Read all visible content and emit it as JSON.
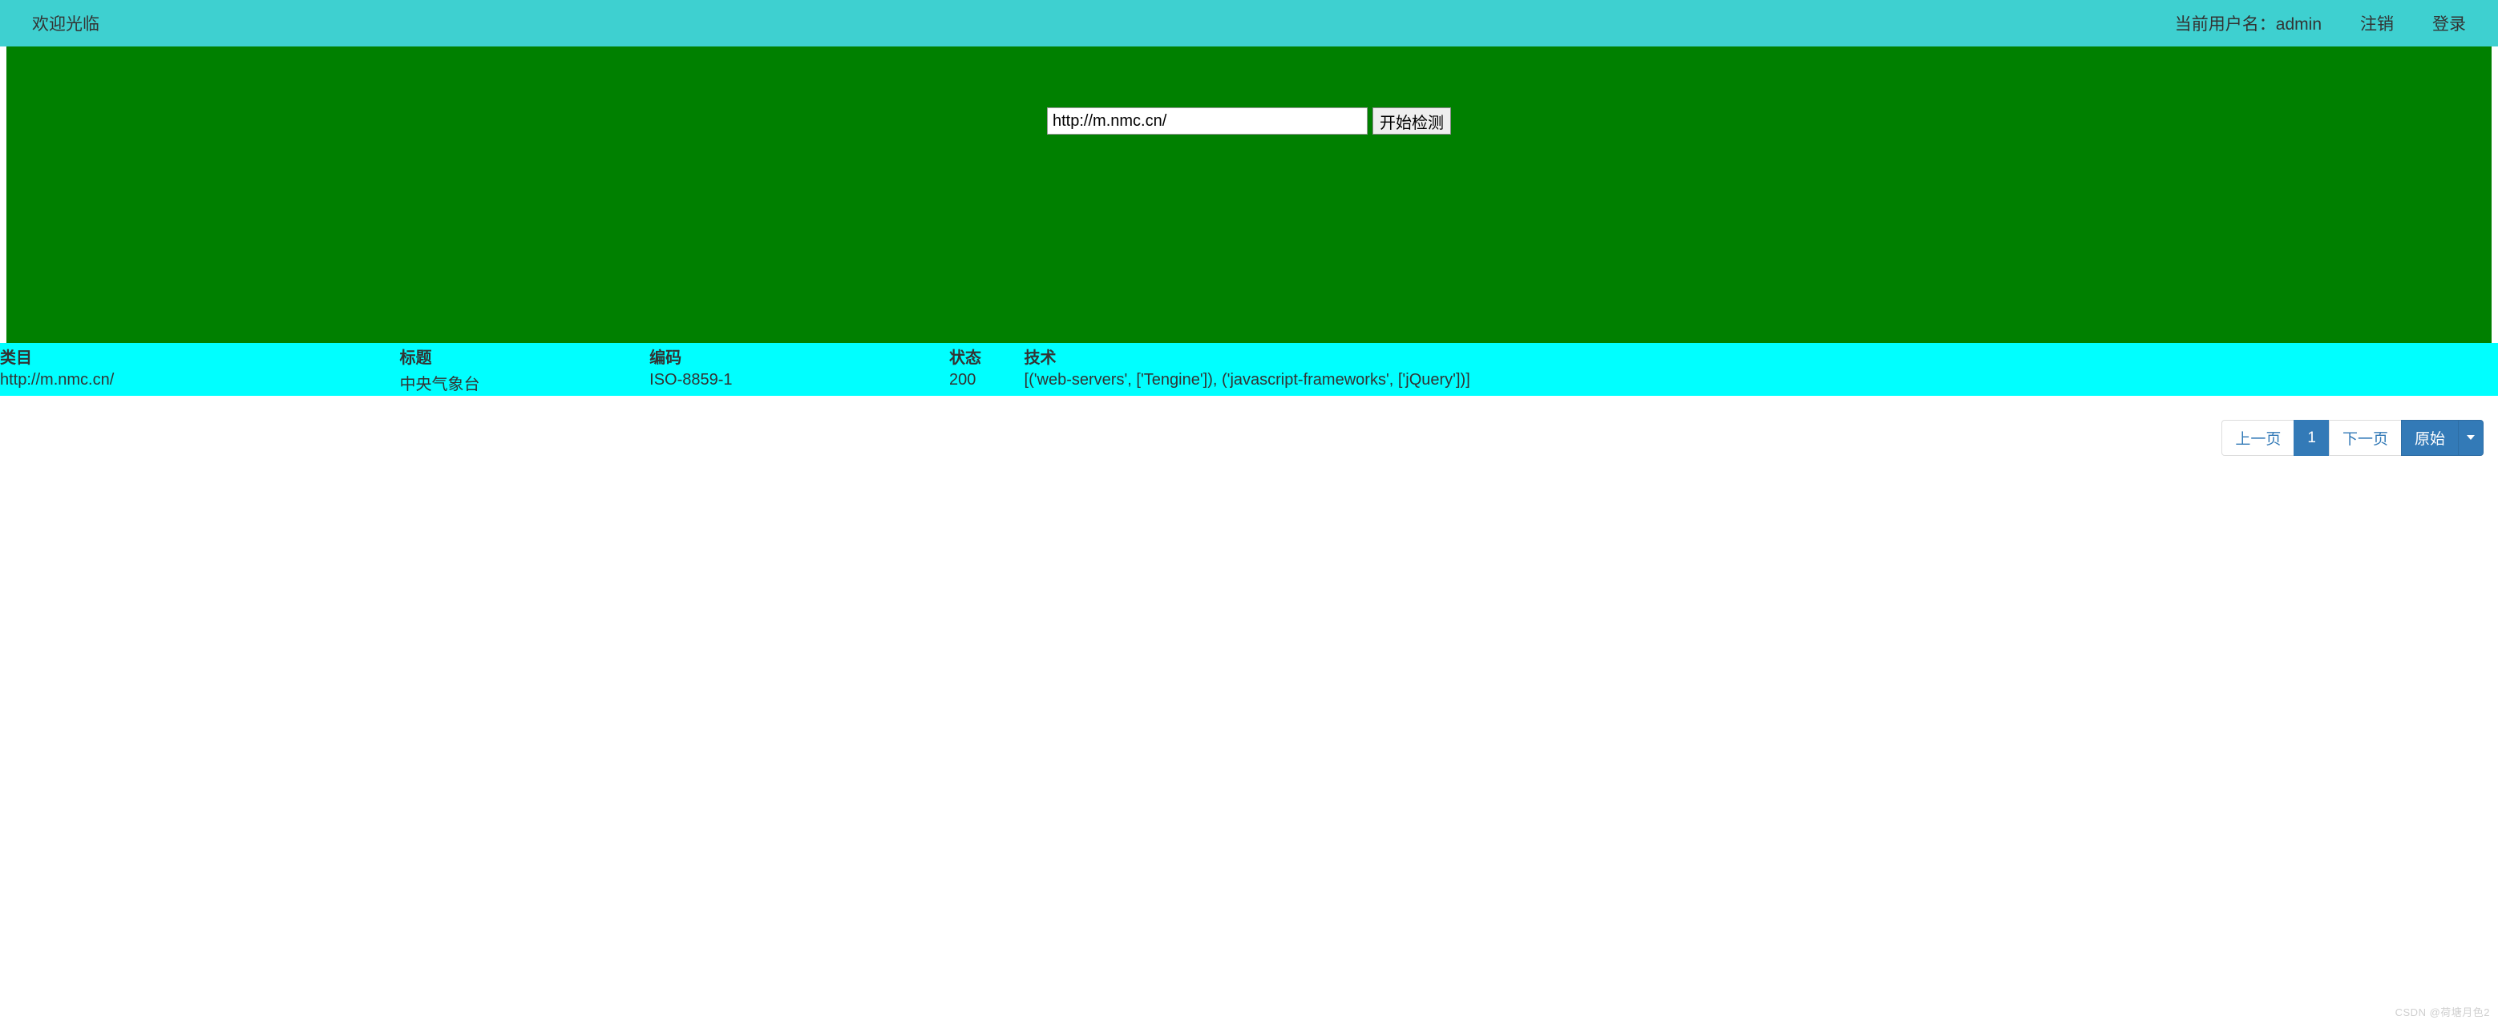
{
  "header": {
    "welcome": "欢迎光临",
    "user_label": "当前用户名：admin",
    "logout": "注销",
    "login": "登录"
  },
  "search": {
    "value": "http://m.nmc.cn/",
    "button": "开始检测"
  },
  "table": {
    "headers": {
      "category": "类目",
      "title": "标题",
      "encoding": "编码",
      "status": "状态",
      "tech": "技术"
    },
    "rows": [
      {
        "category": "http://m.nmc.cn/",
        "title": "中央气象台",
        "encoding": "ISO-8859-1",
        "status": "200",
        "tech": "[('web-servers', ['Tengine']), ('javascript-frameworks', ['jQuery'])]"
      }
    ]
  },
  "pagination": {
    "prev": "上一页",
    "page": "1",
    "next": "下一页",
    "original": "原始"
  },
  "watermark": "CSDN @荷塘月色2"
}
